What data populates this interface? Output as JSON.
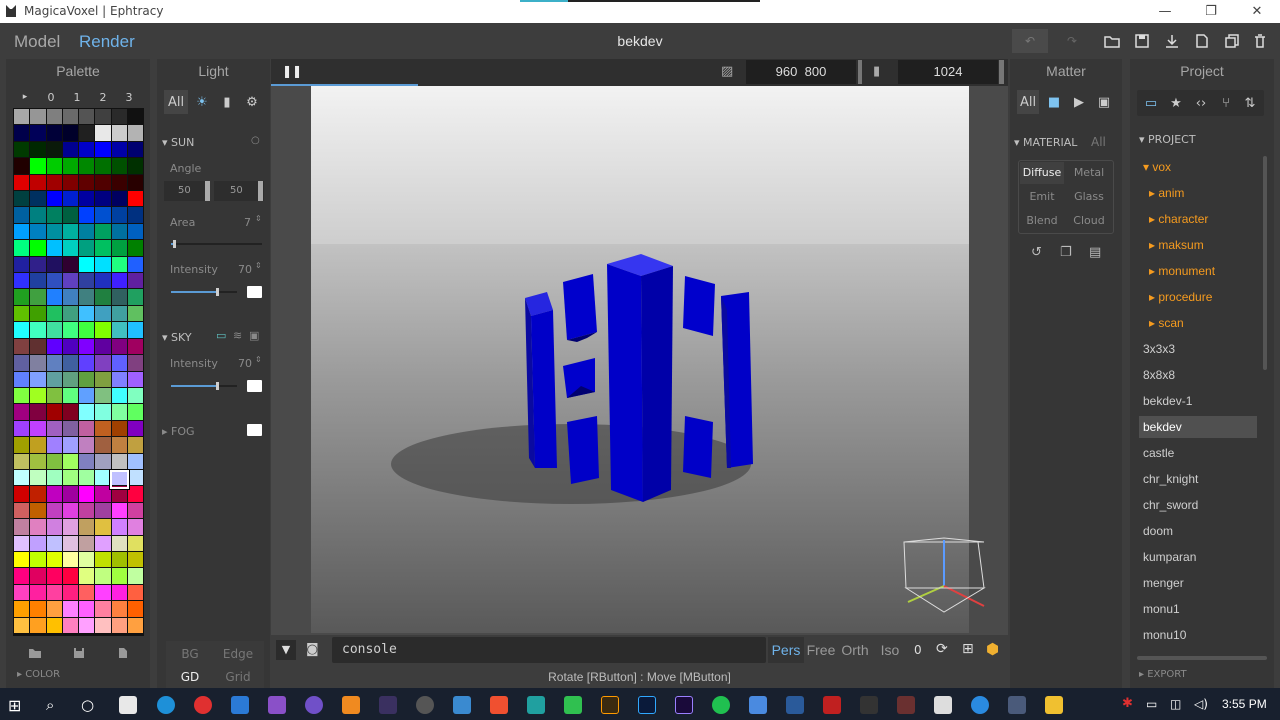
{
  "window": {
    "title": "MagicaVoxel | Ephtracy",
    "minimize": "—",
    "maximize": "❐",
    "close": "✕"
  },
  "appbar": {
    "mode_model": "Model",
    "mode_render": "Render",
    "file_name": "bekdev",
    "accent_color": "#6fb3ea"
  },
  "palette": {
    "title": "Palette",
    "tabs": [
      "▸",
      "0",
      "1",
      "2",
      "3"
    ],
    "color_section": "COLOR",
    "colors": [
      "#a8a8a8",
      "#969696",
      "#7f7f7f",
      "#6a6a6a",
      "#545454",
      "#404040",
      "#2a2a2a",
      "#111111",
      "#00004a",
      "#000058",
      "#000038",
      "#00002a",
      "#202020",
      "#e8e8e8",
      "#cccccc",
      "#b3b3b3",
      "#003a00",
      "#002800",
      "#0a1a0a",
      "#000090",
      "#0000c8",
      "#0000ff",
      "#0000a8",
      "#000070",
      "#200000",
      "#00ff00",
      "#00cc00",
      "#00aa00",
      "#008800",
      "#007000",
      "#005000",
      "#003000",
      "#e00000",
      "#c00000",
      "#a00000",
      "#800000",
      "#600000",
      "#500000",
      "#3a0000",
      "#280000",
      "#004040",
      "#003060",
      "#0000ff",
      "#0020d0",
      "#0000a0",
      "#000080",
      "#000060",
      "#ff0000",
      "#0060a0",
      "#008080",
      "#008060",
      "#006040",
      "#0040ff",
      "#0050d0",
      "#0040a0",
      "#003080",
      "#00a0ff",
      "#0080c0",
      "#0090a0",
      "#00b0a0",
      "#0080a0",
      "#00a060",
      "#0070a0",
      "#0060c0",
      "#00ff80",
      "#00ff00",
      "#00c0ff",
      "#00d0c0",
      "#00a080",
      "#00c060",
      "#00a040",
      "#008000",
      "#2020a0",
      "#30208a",
      "#201060",
      "#300030",
      "#00ffff",
      "#00e0ff",
      "#20ff80",
      "#2060ff",
      "#3030ff",
      "#2040a0",
      "#3050c0",
      "#6040c0",
      "#3040a0",
      "#2030c0",
      "#4020ff",
      "#6020a0",
      "#20a020",
      "#40a040",
      "#2080ff",
      "#4080c0",
      "#408080",
      "#208040",
      "#306060",
      "#20a060",
      "#60c000",
      "#40a000",
      "#20c060",
      "#40a080",
      "#40c0ff",
      "#40a0c0",
      "#40a0a0",
      "#60c060",
      "#20ffff",
      "#40ffc0",
      "#40e0a0",
      "#40ff80",
      "#40ff40",
      "#80ff00",
      "#40c0c0",
      "#20c0ff",
      "#804040",
      "#603030",
      "#6000ff",
      "#5000c0",
      "#8000ff",
      "#6000a0",
      "#800080",
      "#a00060",
      "#6060a0",
      "#8080a0",
      "#6080c0",
      "#4060a0",
      "#6040ff",
      "#8040c0",
      "#6060ff",
      "#804080",
      "#6080ff",
      "#80a0ff",
      "#60a0a0",
      "#60a080",
      "#60a040",
      "#80a040",
      "#8080ff",
      "#a060ff",
      "#80ff40",
      "#a0ff20",
      "#80c040",
      "#60ff80",
      "#60a0ff",
      "#80c080",
      "#40ffff",
      "#80ffc0",
      "#a00080",
      "#800040",
      "#a00000",
      "#800020",
      "#80ffff",
      "#80ffe0",
      "#80ffa0",
      "#60ff60",
      "#a040ff",
      "#c040ff",
      "#a060c0",
      "#8060a0",
      "#c060a0",
      "#c06020",
      "#a04000",
      "#8000c0",
      "#a0a000",
      "#c0a020",
      "#a080ff",
      "#a0a0ff",
      "#c080c0",
      "#a06040",
      "#c08040",
      "#c0a040",
      "#c0c060",
      "#a0c040",
      "#80c040",
      "#a0ff60",
      "#8080c0",
      "#a0a0c0",
      "#c0c0c0",
      "#a0c0ff",
      "#c0ffff",
      "#c0ffc0",
      "#a0ffc0",
      "#a0ff80",
      "#a0ffa0",
      "#a0ffff",
      "#c0c0ff",
      "#c0e0ff",
      "#d00000",
      "#c02000",
      "#c000c0",
      "#a000a0",
      "#ff00ff",
      "#c000a0",
      "#a00040",
      "#ff0040",
      "#d06060",
      "#c06000",
      "#c040c0",
      "#e040e0",
      "#c040a0",
      "#a040a0",
      "#ff40ff",
      "#d040a0",
      "#c080a0",
      "#e080c0",
      "#d080e0",
      "#e0a0e0",
      "#c0a060",
      "#e0c040",
      "#d080ff",
      "#e080e0",
      "#e0c0ff",
      "#c0a0ff",
      "#c0c0ff",
      "#e0c0e0",
      "#c0a0a0",
      "#e0a0ff",
      "#e0e0c0",
      "#e0e060",
      "#ffff00",
      "#c0ff00",
      "#e0ff00",
      "#ffffa0",
      "#e0ffa0",
      "#c0e000",
      "#a0c000",
      "#c0c000",
      "#ff0080",
      "#e00060",
      "#ff0060",
      "#ff0040",
      "#e0ff80",
      "#c0ff80",
      "#a0ff40",
      "#c0ffa0",
      "#ff40c0",
      "#ff20a0",
      "#ff40a0",
      "#ff2080",
      "#ff6060",
      "#ff40ff",
      "#ff20e0",
      "#ff6040",
      "#ffa000",
      "#ff8000",
      "#ffa040",
      "#ff80ff",
      "#ff60ff",
      "#ff80a0",
      "#ff8040",
      "#ff6000",
      "#ffc040",
      "#ffa020",
      "#ffc000",
      "#ff80c0",
      "#ffa0ff",
      "#ffc0c0",
      "#ffa080",
      "#ffa040",
      "#ffc080",
      "#ffe0a0",
      "#ffff40",
      "#ffe060",
      "#ffc0ff",
      "#ffe0ff",
      "#ffa0c0",
      "#ffe0c0",
      "#ffffc0",
      "#ffffe0",
      "#fff0a0",
      "#ffff80",
      "#ffff00",
      "#e0e0ff",
      "#ffc0e0",
      "#ffe0e0"
    ]
  },
  "light": {
    "title": "Light",
    "tab_all": "All",
    "sun_label": "SUN",
    "angle_label": "Angle",
    "angle_a": "50",
    "angle_b": "50",
    "area_label": "Area",
    "area_value": "7",
    "area": 0.03,
    "intensity_label": "Intensity",
    "sun_intensity": "70",
    "sun_intensity_level": 0.7,
    "sky_label": "SKY",
    "sky_intensity": "70",
    "sky_intensity_level": 0.7,
    "fog_label": "FOG",
    "bg": "BG",
    "edge": "Edge",
    "gd": "GD",
    "grid": "Grid"
  },
  "viewport": {
    "width": "960",
    "height": "800",
    "samples": "1024",
    "progress": 0.2,
    "console_text": "console",
    "status": "Rotate [RButton] : Move [MButton]",
    "views": [
      "Pers",
      "Free",
      "Orth",
      "Iso"
    ],
    "zero": "0"
  },
  "matter": {
    "title": "Matter",
    "tab_all": "All",
    "section": "MATERIAL",
    "section_all": "All",
    "buttons": [
      "Diffuse",
      "Metal",
      "Emit",
      "Glass",
      "Blend",
      "Cloud"
    ]
  },
  "project": {
    "title": "Project",
    "section": "PROJECT",
    "root": "vox",
    "folders": [
      "anim",
      "character",
      "maksum",
      "monument",
      "procedure",
      "scan"
    ],
    "files": [
      "3x3x3",
      "8x8x8",
      "bekdev-1",
      "bekdev",
      "castle",
      "chr_knight",
      "chr_sword",
      "doom",
      "kumparan",
      "menger",
      "monu1",
      "monu10"
    ],
    "selected": "bekdev",
    "export": "EXPORT"
  },
  "taskbar": {
    "time": "3:55 PM"
  }
}
